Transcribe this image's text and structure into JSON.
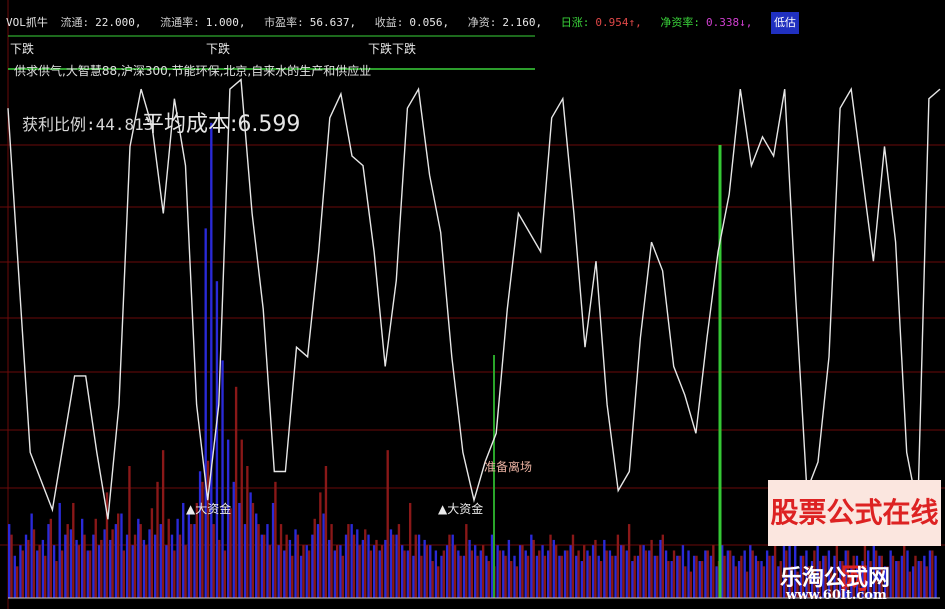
{
  "header": {
    "indicator": "VOL抓牛",
    "items": [
      {
        "label": "流通:",
        "value": "22.000,"
      },
      {
        "label": "流通率:",
        "value": "1.000,"
      },
      {
        "label": "市盈率:",
        "value": "56.637,"
      },
      {
        "label": "收益:",
        "value": "0.056,"
      },
      {
        "label": "净资:",
        "value": "2.160,"
      },
      {
        "label": "日涨:",
        "value": "0.954↑,"
      },
      {
        "label": "净资率:",
        "value": "0.338↓,"
      }
    ],
    "tail": "低估"
  },
  "concepts": "供求供气,大智慧88,沪深300,节能环保,北京,自来水的生产和供应业",
  "profit_ratio": "获利比例:44.813",
  "avg_cost": "平均成本:6.599",
  "chart_data": {
    "type": "bar",
    "title": "",
    "grid": true,
    "ylim": [
      0,
      100
    ],
    "annotations": [
      {
        "text": "下跌",
        "x": 3,
        "y": 100
      },
      {
        "text": "下跌",
        "x": 43,
        "y": 100
      },
      {
        "text": "下跌",
        "x": 77,
        "y": 100
      },
      {
        "text": "下跌",
        "x": 82,
        "y": 100
      },
      {
        "text": "▲大资金",
        "x": 38,
        "y": 15
      },
      {
        "text": "▲大资金",
        "x": 89,
        "y": 15
      },
      {
        "text": "准备离场",
        "x": 99,
        "y": 22
      }
    ],
    "volume": [
      {
        "name": "red",
        "values": [
          12,
          6,
          9,
          11,
          13,
          10,
          8,
          15,
          7,
          9,
          14,
          18,
          10,
          12,
          9,
          15,
          11,
          20,
          13,
          16,
          9,
          25,
          12,
          14,
          10,
          17,
          22,
          28,
          15,
          9,
          12,
          10,
          14,
          18,
          22,
          26,
          14,
          11,
          9,
          17,
          40,
          30,
          25,
          18,
          14,
          12,
          10,
          22,
          14,
          12,
          8,
          12,
          10,
          9,
          15,
          20,
          25,
          14,
          10,
          8,
          14,
          12,
          10,
          13,
          9,
          11,
          10,
          28,
          12,
          14,
          9,
          18,
          12,
          8,
          10,
          7,
          6,
          9,
          12,
          10,
          8,
          14,
          9,
          8,
          10,
          7,
          6,
          9,
          8,
          7,
          6,
          10,
          8,
          11,
          9,
          8,
          12,
          10,
          8,
          9,
          12,
          9,
          10,
          8,
          11,
          7,
          9,
          8,
          12,
          10,
          14,
          8,
          10,
          9,
          11,
          8,
          12,
          7,
          9,
          8,
          6,
          5,
          8,
          7,
          9,
          10,
          7,
          8,
          9,
          6,
          8,
          5,
          9,
          7,
          6,
          8,
          10,
          7,
          9,
          6,
          5,
          8,
          6,
          9,
          7,
          8,
          6,
          10,
          7,
          9,
          8,
          6,
          11,
          7,
          9,
          8,
          6,
          8,
          7,
          10,
          5,
          8,
          7,
          6,
          9
        ]
      },
      {
        "name": "blue",
        "values": [
          14,
          8,
          10,
          12,
          16,
          9,
          11,
          14,
          10,
          18,
          12,
          13,
          11,
          15,
          9,
          12,
          10,
          13,
          11,
          14,
          16,
          12,
          10,
          15,
          11,
          13,
          12,
          14,
          10,
          12,
          15,
          18,
          16,
          14,
          24,
          70,
          90,
          60,
          45,
          30,
          22,
          18,
          14,
          20,
          16,
          12,
          14,
          18,
          10,
          9,
          11,
          13,
          8,
          10,
          12,
          14,
          16,
          11,
          9,
          10,
          12,
          14,
          13,
          11,
          12,
          10,
          9,
          11,
          13,
          12,
          10,
          9,
          8,
          12,
          11,
          10,
          9,
          8,
          10,
          12,
          9,
          8,
          11,
          10,
          9,
          8,
          12,
          10,
          9,
          11,
          8,
          10,
          9,
          12,
          8,
          10,
          9,
          11,
          8,
          9,
          10,
          8,
          7,
          9,
          10,
          8,
          11,
          9,
          8,
          10,
          9,
          7,
          8,
          10,
          9,
          8,
          11,
          9,
          7,
          8,
          10,
          9,
          8,
          7,
          9,
          8,
          6,
          10,
          9,
          8,
          7,
          9,
          10,
          8,
          7,
          9,
          8,
          6,
          12,
          22,
          10,
          8,
          9,
          7,
          10,
          8,
          9,
          8,
          7,
          9,
          6,
          8,
          7,
          9,
          10,
          8,
          6,
          9,
          7,
          8,
          9,
          6,
          7,
          8,
          9,
          8
        ]
      }
    ],
    "lines": [
      {
        "name": "white",
        "x": [
          0,
          4,
          8,
          12,
          14,
          16,
          18,
          20,
          22,
          24,
          26,
          28,
          30,
          32,
          34,
          36,
          38,
          40,
          42,
          44,
          46,
          48,
          50,
          52,
          54,
          56,
          58,
          60,
          62,
          64,
          66,
          68,
          70,
          72,
          74,
          76,
          78,
          80,
          82,
          84,
          86,
          88,
          90,
          92,
          94,
          96,
          98,
          100,
          102,
          104,
          106,
          108,
          110,
          112,
          114,
          116,
          118,
          120,
          122,
          124,
          126,
          128,
          130,
          132,
          134,
          136,
          138,
          140,
          142,
          144,
          146,
          148,
          150,
          152,
          154,
          156,
          158,
          160,
          162,
          164,
          166,
          168
        ],
        "y": [
          92,
          20,
          8,
          36,
          36,
          20,
          6,
          30,
          84,
          96,
          88,
          70,
          94,
          80,
          30,
          10,
          30,
          96,
          98,
          70,
          50,
          16,
          16,
          42,
          40,
          62,
          90,
          95,
          82,
          80,
          62,
          38,
          56,
          92,
          96,
          78,
          66,
          40,
          20,
          10,
          18,
          24,
          50,
          70,
          66,
          62,
          90,
          94,
          70,
          42,
          60,
          30,
          12,
          16,
          44,
          64,
          58,
          38,
          32,
          24,
          44,
          62,
          74,
          96,
          80,
          86,
          82,
          96,
          52,
          12,
          18,
          40,
          92,
          96,
          78,
          60,
          84,
          64,
          20,
          8,
          94,
          96
        ]
      },
      {
        "name": "green",
        "x": [
          0,
          168
        ],
        "y": [
          100,
          100
        ]
      }
    ]
  },
  "watermark": {
    "banner": "股票公式在线网",
    "site": "乐淘公式网",
    "url": "www.60lt.com"
  }
}
